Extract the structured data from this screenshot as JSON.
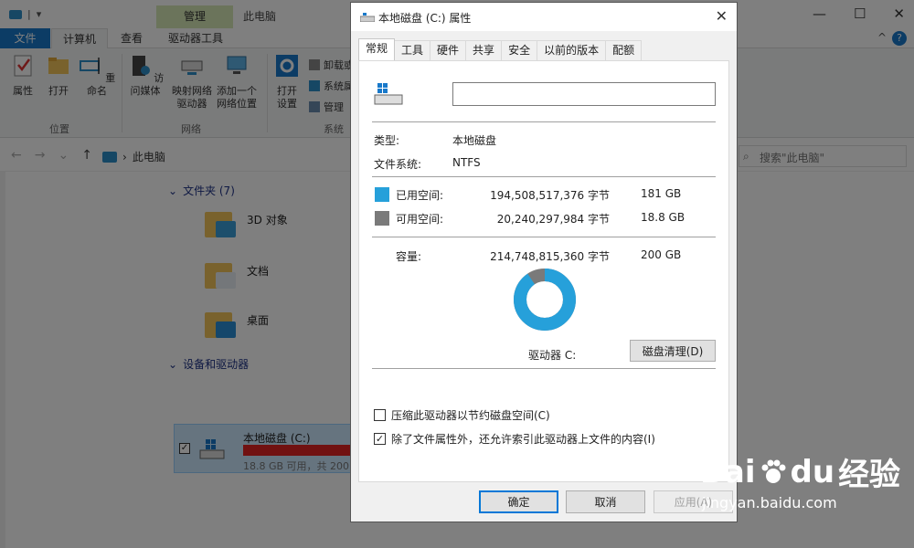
{
  "explorer": {
    "window_title": "此电脑",
    "context_tab": "管理",
    "menu": {
      "file": "文件",
      "computer": "计算机",
      "view": "查看",
      "drive_tools": "驱动器工具"
    },
    "ribbon": {
      "properties": "属性",
      "open": "打开",
      "rename": "重命名",
      "access_media": "访问媒体",
      "map_drive_1": "映射网络",
      "map_drive_2": "驱动器",
      "add_net_1": "添加一个",
      "add_net_2": "网络位置",
      "open_settings_1": "打开",
      "open_settings_2": "设置",
      "uninstall": "卸载或",
      "sysprops": "系统属",
      "manage": "管理",
      "group_location": "位置",
      "group_network": "网络",
      "group_system": "系统"
    },
    "address": {
      "path": "此电脑",
      "search_placeholder": "搜索\"此电脑\""
    },
    "folders_header": "文件夹 (7)",
    "folders": [
      "3D 对象",
      "文档",
      "桌面"
    ],
    "devices_header": "设备和驱动器",
    "drive": {
      "name": "本地磁盘 (C:)",
      "info": "18.8 GB 可用，共 200 GB"
    }
  },
  "dialog": {
    "title": "本地磁盘 (C:) 属性",
    "tabs": [
      "常规",
      "工具",
      "硬件",
      "共享",
      "安全",
      "以前的版本",
      "配额"
    ],
    "active_tab": "常规",
    "name_value": "",
    "type_label": "类型:",
    "type_value": "本地磁盘",
    "fs_label": "文件系统:",
    "fs_value": "NTFS",
    "used_label": "已用空间:",
    "used_bytes": "194,508,517,376 字节",
    "used_gb": "181 GB",
    "free_label": "可用空间:",
    "free_bytes": "20,240,297,984 字节",
    "free_gb": "18.8 GB",
    "capacity_label": "容量:",
    "capacity_bytes": "214,748,815,360 字节",
    "capacity_gb": "200 GB",
    "drive_label": "驱动器 C:",
    "cleanup_button": "磁盘清理(D)",
    "compress_label": "压缩此驱动器以节约磁盘空间(C)",
    "compress_checked": false,
    "index_label": "除了文件属性外，还允许索引此驱动器上文件的内容(I)",
    "index_checked": true,
    "ok": "确定",
    "cancel": "取消",
    "apply": "应用(A)",
    "used_fraction": 0.9057,
    "colors": {
      "used": "#26a0da",
      "free": "#7a7a7a"
    }
  },
  "watermark": {
    "brand": "Bai",
    "brand_tail": "du",
    "cn": "经验",
    "url": "jingyan.baidu.com"
  }
}
